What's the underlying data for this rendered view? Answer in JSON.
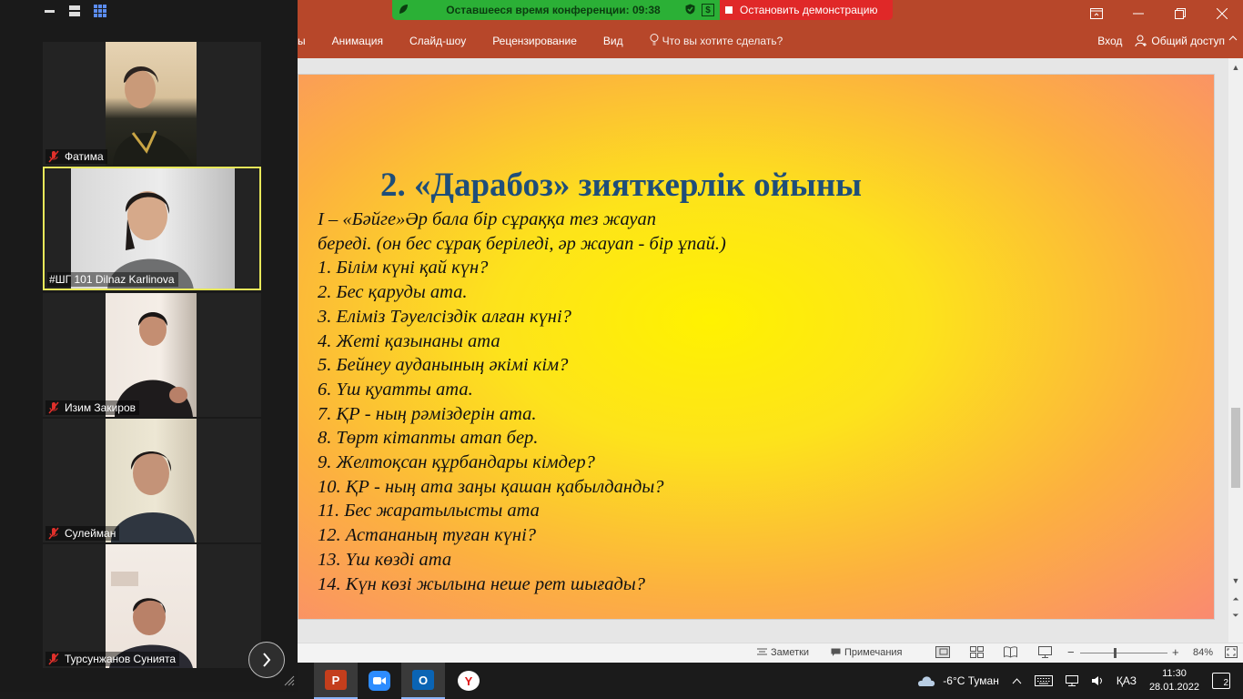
{
  "ribbon": {
    "menu": [
      "ды",
      "Анимация",
      "Слайд-шоу",
      "Рецензирование",
      "Вид"
    ],
    "tell_me": "Что вы хотите сделать?",
    "sign_in": "Вход",
    "share": "Общий доступ",
    "accent": "#b7472a"
  },
  "share_banner": {
    "timer": "Оставшееся время конференции: 09:38",
    "stop_label": "Остановить демонстрацию"
  },
  "slide": {
    "title": "2. «Дарабоз» зияткерлік ойыны",
    "lines": [
      "І – «Бәйге»Әр бала бір сұраққа тез жауап",
      "береді. (он бес сұрақ беріледі, әр жауап - бір ұпай.)",
      "1. Білім күні қай күн?",
      "2. Бес қаруды ата.",
      "3. Еліміз Тәуелсіздік алған күні?",
      "4. Жеті қазынаны ата",
      "5. Бейнеу ауданының әкімі кім?",
      "6. Үш қуатты ата.",
      "7. ҚР - ның рәміздерін ата.",
      "8. Төрт кітапты атап бер.",
      "9. Желтоқсан құрбандары кімдер?",
      "10. ҚР - ның ата заңы қашан қабылданды?",
      "11. Бес жаратылысты ата",
      "12. Астананың туған күні?",
      "13. Үш көзді ата",
      "14. Күн көзі жылына неше рет шығады?"
    ]
  },
  "participants": [
    {
      "name": "Фатима",
      "muted": true,
      "active": false
    },
    {
      "name": "#ШГ 101 Dilnaz Karlinova",
      "muted": false,
      "active": true
    },
    {
      "name": "Изим Закиров",
      "muted": true,
      "active": false
    },
    {
      "name": "Сулейман",
      "muted": true,
      "active": false
    },
    {
      "name": "Турсунжанов Сунията",
      "muted": true,
      "active": false
    }
  ],
  "statusbar": {
    "notes": "Заметки",
    "comments": "Примечания",
    "zoom": "84%"
  },
  "taskbar": {
    "weather": "-6°C  Туман",
    "lang": "ҚАЗ",
    "time": "11:30",
    "date": "28.01.2022",
    "notifications": "2"
  }
}
